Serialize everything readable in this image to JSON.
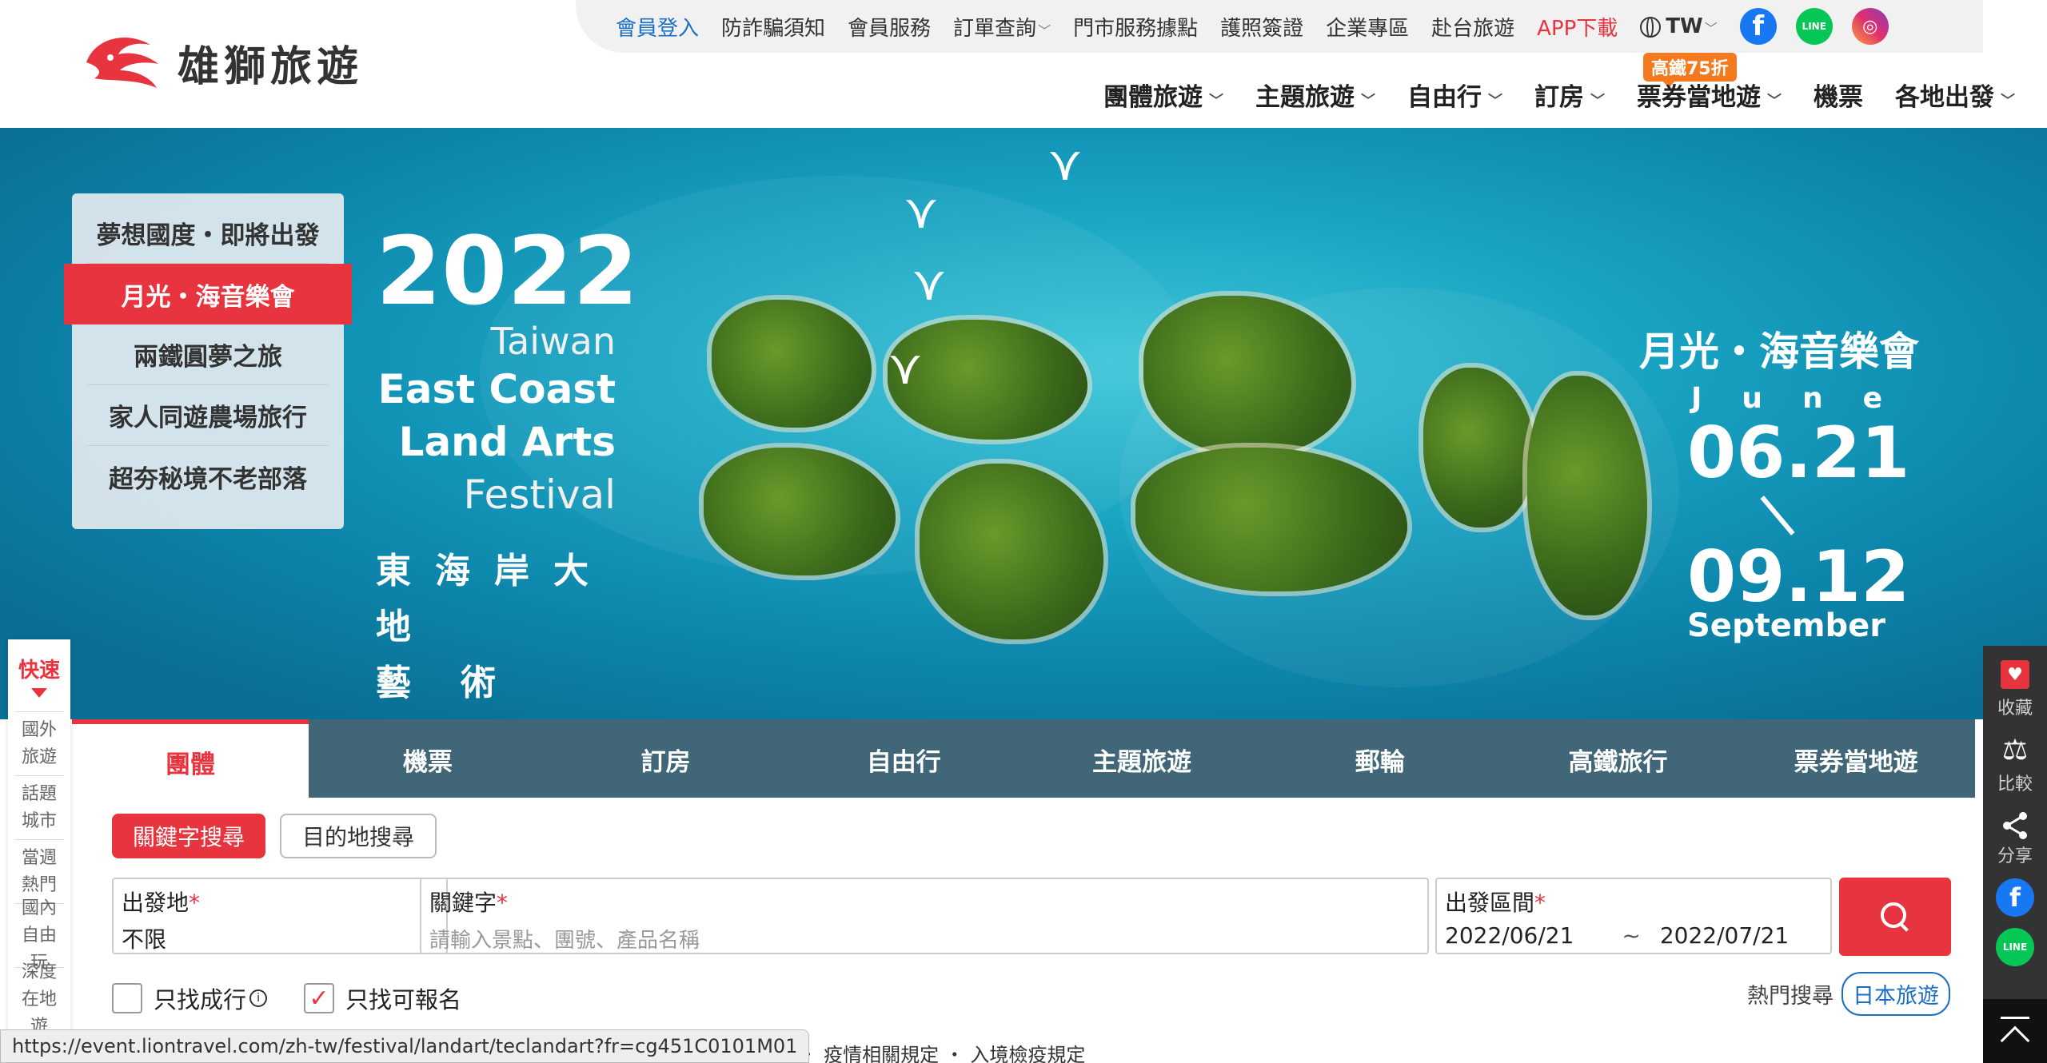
{
  "logo": {
    "text": "雄獅旅遊"
  },
  "topbar": {
    "links": [
      "會員登入",
      "防詐騙須知",
      "會員服務",
      "訂單查詢",
      "門市服務據點",
      "護照簽證",
      "企業專區",
      "赴台旅遊",
      "APP下載"
    ],
    "lang": "TW",
    "social": [
      "facebook-icon",
      "line-icon",
      "instagram-icon"
    ],
    "line_label": "LINE"
  },
  "mainnav": {
    "items": [
      "團體旅遊",
      "主題旅遊",
      "自由行",
      "訂房",
      "票券當地遊",
      "機票",
      "各地出發"
    ],
    "badge": "高鐵75折"
  },
  "banner": {
    "year": "2022",
    "en_line1": "Taiwan",
    "en_line2": "East Coast",
    "en_line3": "Land Arts",
    "en_line4": "Festival",
    "zh_line1": "東海岸大地",
    "zh_line2": "藝術節",
    "concert": "月光・海音樂會",
    "month1": "June",
    "date1": "06.21",
    "date2": "09.12",
    "month2": "September",
    "menu": [
      "夢想國度・即將出發",
      "月光・海音樂會",
      "兩鐵圓夢之旅",
      "家人同遊農場旅行",
      "超夯秘境不老部落"
    ]
  },
  "search": {
    "tabs": [
      "團體",
      "機票",
      "訂房",
      "自由行",
      "主題旅遊",
      "郵輪",
      "高鐵旅行",
      "票券當地遊"
    ],
    "mode_keyword": "關鍵字搜尋",
    "mode_destination": "目的地搜尋",
    "depart_label": "出發地",
    "depart_value": "不限",
    "keyword_label": "關鍵字",
    "keyword_placeholder": "請輸入景點、團號、產品名稱",
    "range_label": "出發區間",
    "date_from": "2022/06/21",
    "date_sep": "~",
    "date_to": "2022/07/21",
    "required_mark": "*",
    "check_confirmed": "只找成行",
    "check_available": "只找可報名",
    "hot_label": "熱門搜尋",
    "hot_tag": "日本旅遊"
  },
  "quick_rail": {
    "title": "快速",
    "items": [
      "國外旅遊",
      "話題城市",
      "當週熱門",
      "國內自由玩",
      "深度在地遊"
    ]
  },
  "right_rail": {
    "collect": "收藏",
    "compare": "比較",
    "share": "分享",
    "line_label": "LINE"
  },
  "status_url": "https://event.liontravel.com/zh-tw/festival/landart/teclandart?fr=cg451C0101M01",
  "below_text": "旅遊徵才非你莫屬 ・ 熱門旅遊議題        公告 ・ 疫情相關規定 ・ 入境檢疫規定"
}
